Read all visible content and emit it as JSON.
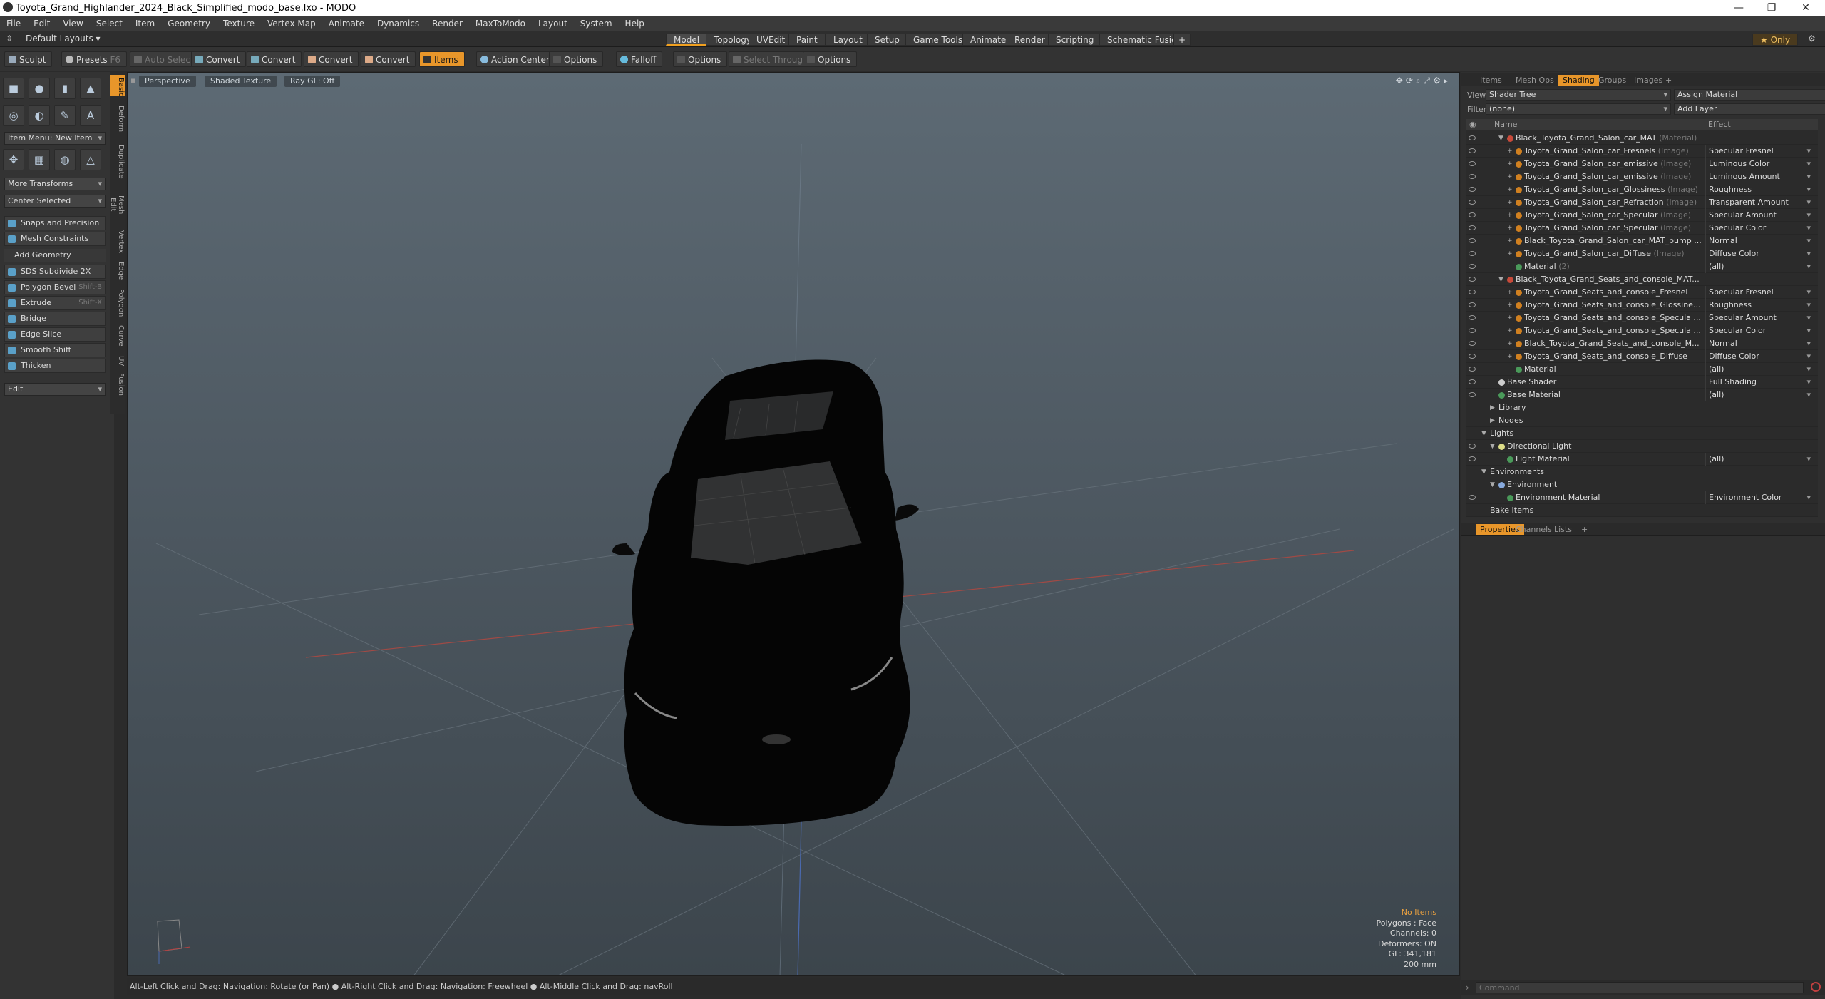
{
  "window": {
    "title": "Toyota_Grand_Highlander_2024_Black_Simplified_modo_base.lxo - MODO"
  },
  "menu": [
    "File",
    "Edit",
    "View",
    "Select",
    "Item",
    "Geometry",
    "Texture",
    "Vertex Map",
    "Animate",
    "Dynamics",
    "Render",
    "MaxToModo",
    "Layout",
    "System",
    "Help"
  ],
  "layout": {
    "preset": "Default Layouts",
    "tabs": [
      "Model",
      "Topology",
      "UVEdit",
      "Paint",
      "Layout",
      "Setup",
      "Game Tools",
      "Animate",
      "Render",
      "Scripting",
      "Schematic Fusion"
    ],
    "active": "Model",
    "only": "Only"
  },
  "toolbar": {
    "sculpt": "Sculpt",
    "presets": "Presets",
    "presets_key": "F6",
    "auto_select": "Auto Select",
    "convert": "Convert",
    "items": "Items",
    "action_center": "Action Center",
    "options": "Options",
    "falloff": "Falloff",
    "select_through": "Select Through"
  },
  "left": {
    "vtabs": [
      "Basic",
      "Deform",
      "Duplicate",
      "Mesh Edit",
      "Vertex",
      "Edge",
      "Polygon",
      "Curve",
      "UV",
      "Fusion"
    ],
    "item_menu": "Item Menu: New Item",
    "more_transforms": "More Transforms",
    "center_selected": "Center Selected",
    "snaps": "Snaps and Precision",
    "mesh_constraints": "Mesh Constraints",
    "add_geometry": "Add Geometry",
    "tools": [
      {
        "label": "SDS Subdivide 2X",
        "key": ""
      },
      {
        "label": "Polygon Bevel",
        "key": "Shift-B"
      },
      {
        "label": "Extrude",
        "key": "Shift-X"
      },
      {
        "label": "Bridge",
        "key": ""
      },
      {
        "label": "Edge Slice",
        "key": ""
      },
      {
        "label": "Smooth Shift",
        "key": ""
      },
      {
        "label": "Thicken",
        "key": ""
      }
    ],
    "edit": "Edit"
  },
  "viewport": {
    "view": "Perspective",
    "shading": "Shaded Texture",
    "raygl": "Ray GL: Off",
    "info": {
      "items": "No Items",
      "polygons": "Polygons : Face",
      "channels": "Channels: 0",
      "deformers": "Deformers: ON",
      "gl": "GL: 341,181",
      "scale": "200 mm"
    }
  },
  "status": "Alt-Left Click and Drag: Navigation: Rotate (or Pan) ● Alt-Right Click and Drag: Navigation: Freewheel ● Alt-Middle Click and Drag: navRoll",
  "right": {
    "tabs": [
      "Items",
      "Mesh Ops",
      "Shading",
      "Groups",
      "Images"
    ],
    "active": "Shading",
    "view_label": "View",
    "view_value": "Shader Tree",
    "assign": "Assign Material",
    "filter_label": "Filter",
    "filter_value": "(none)",
    "add_layer": "Add Layer",
    "col_name": "Name",
    "col_effect": "Effect",
    "rows": [
      {
        "indent": 2,
        "arrow": "▼",
        "dot": "#c84a3a",
        "name": "Black_Toyota_Grand_Salon_car_MAT",
        "tag": "(Material)",
        "effect": ""
      },
      {
        "indent": 3,
        "arrow": "+",
        "dot": "#d08020",
        "name": "Toyota_Grand_Salon_car_Fresnels",
        "tag": "(Image)",
        "effect": "Specular Fresnel"
      },
      {
        "indent": 3,
        "arrow": "+",
        "dot": "#d08020",
        "name": "Toyota_Grand_Salon_car_emissive",
        "tag": "(Image)",
        "effect": "Luminous Color"
      },
      {
        "indent": 3,
        "arrow": "+",
        "dot": "#d08020",
        "name": "Toyota_Grand_Salon_car_emissive",
        "tag": "(Image)",
        "effect": "Luminous Amount"
      },
      {
        "indent": 3,
        "arrow": "+",
        "dot": "#d08020",
        "name": "Toyota_Grand_Salon_car_Glossiness",
        "tag": "(Image)",
        "effect": "Roughness"
      },
      {
        "indent": 3,
        "arrow": "+",
        "dot": "#d08020",
        "name": "Toyota_Grand_Salon_car_Refraction",
        "tag": "(Image)",
        "effect": "Transparent Amount"
      },
      {
        "indent": 3,
        "arrow": "+",
        "dot": "#d08020",
        "name": "Toyota_Grand_Salon_car_Specular",
        "tag": "(Image)",
        "effect": "Specular Amount"
      },
      {
        "indent": 3,
        "arrow": "+",
        "dot": "#d08020",
        "name": "Toyota_Grand_Salon_car_Specular",
        "tag": "(Image)",
        "effect": "Specular Color"
      },
      {
        "indent": 3,
        "arrow": "+",
        "dot": "#d08020",
        "name": "Black_Toyota_Grand_Salon_car_MAT_bump ...",
        "tag": "",
        "effect": "Normal"
      },
      {
        "indent": 3,
        "arrow": "+",
        "dot": "#d08020",
        "name": "Toyota_Grand_Salon_car_Diffuse",
        "tag": "(Image)",
        "effect": "Diffuse Color"
      },
      {
        "indent": 3,
        "arrow": "",
        "dot": "#4a9a5a",
        "name": "Material",
        "tag": "(2)",
        "effect": "(all)"
      },
      {
        "indent": 2,
        "arrow": "▼",
        "dot": "#c84a3a",
        "name": "Black_Toyota_Grand_Seats_and_console_MAT...",
        "tag": "",
        "effect": ""
      },
      {
        "indent": 3,
        "arrow": "+",
        "dot": "#d08020",
        "name": "Toyota_Grand_Seats_and_console_Fresnel",
        "tag": "",
        "effect": "Specular Fresnel"
      },
      {
        "indent": 3,
        "arrow": "+",
        "dot": "#d08020",
        "name": "Toyota_Grand_Seats_and_console_Glossine...",
        "tag": "",
        "effect": "Roughness"
      },
      {
        "indent": 3,
        "arrow": "+",
        "dot": "#d08020",
        "name": "Toyota_Grand_Seats_and_console_Specula ...",
        "tag": "",
        "effect": "Specular Amount"
      },
      {
        "indent": 3,
        "arrow": "+",
        "dot": "#d08020",
        "name": "Toyota_Grand_Seats_and_console_Specula ...",
        "tag": "",
        "effect": "Specular Color"
      },
      {
        "indent": 3,
        "arrow": "+",
        "dot": "#d08020",
        "name": "Black_Toyota_Grand_Seats_and_console_M...",
        "tag": "",
        "effect": "Normal"
      },
      {
        "indent": 3,
        "arrow": "+",
        "dot": "#d08020",
        "name": "Toyota_Grand_Seats_and_console_Diffuse",
        "tag": "",
        "effect": "Diffuse Color"
      },
      {
        "indent": 3,
        "arrow": "",
        "dot": "#4a9a5a",
        "name": "Material",
        "tag": "",
        "effect": "(all)"
      },
      {
        "indent": 1,
        "arrow": "",
        "dot": "#cccccc",
        "name": "Base Shader",
        "tag": "",
        "effect": "Full Shading"
      },
      {
        "indent": 1,
        "arrow": "",
        "dot": "#4a9a5a",
        "name": "Base Material",
        "tag": "",
        "effect": "(all)"
      },
      {
        "indent": 1,
        "arrow": "▶",
        "dot": "",
        "name": "Library",
        "tag": "",
        "effect": "",
        "noeye": true
      },
      {
        "indent": 1,
        "arrow": "▶",
        "dot": "",
        "name": "Nodes",
        "tag": "",
        "effect": "",
        "noeye": true
      },
      {
        "indent": 0,
        "arrow": "▼",
        "dot": "",
        "name": "Lights",
        "tag": "",
        "effect": "",
        "noeye": true
      },
      {
        "indent": 1,
        "arrow": "▼",
        "dot": "#dddd88",
        "name": "Directional Light",
        "tag": "",
        "effect": ""
      },
      {
        "indent": 2,
        "arrow": "",
        "dot": "#4a9a5a",
        "name": "Light Material",
        "tag": "",
        "effect": "(all)"
      },
      {
        "indent": 0,
        "arrow": "▼",
        "dot": "",
        "name": "Environments",
        "tag": "",
        "effect": "",
        "noeye": true
      },
      {
        "indent": 1,
        "arrow": "▼",
        "dot": "#88aadd",
        "name": "Environment",
        "tag": "",
        "effect": "",
        "noeye": true
      },
      {
        "indent": 2,
        "arrow": "",
        "dot": "#4a9a5a",
        "name": "Environment Material",
        "tag": "",
        "effect": "Environment Color"
      },
      {
        "indent": 0,
        "arrow": "",
        "dot": "",
        "name": "Bake Items",
        "tag": "",
        "effect": "",
        "noeye": true
      }
    ],
    "lower_tabs": [
      "Properties",
      "Channels",
      "Lists"
    ],
    "lower_active": "Properties",
    "command_placeholder": "Command"
  }
}
